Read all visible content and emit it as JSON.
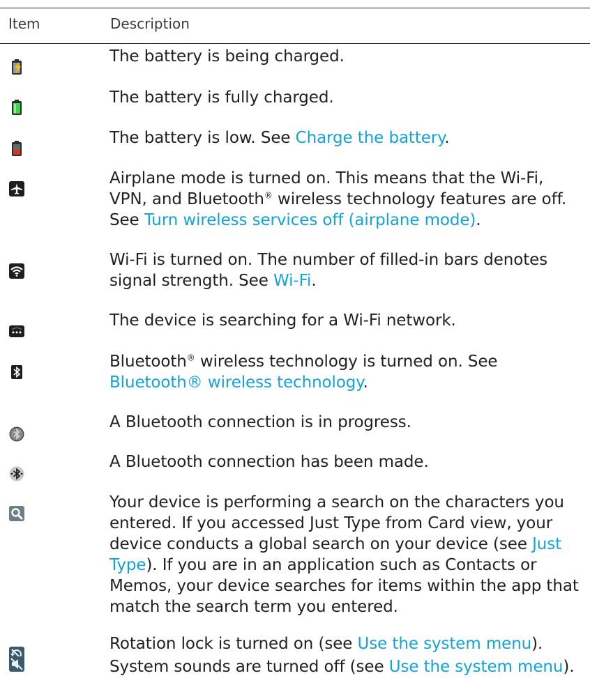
{
  "header": {
    "item": "Item",
    "description": "Description"
  },
  "colors": {
    "link": "#12a3d8",
    "text": "#231f20"
  },
  "rows": [
    {
      "icon": "battery-charging-icon",
      "text": "The battery is being charged."
    },
    {
      "icon": "battery-full-icon",
      "text": "The battery is fully charged."
    },
    {
      "icon": "battery-low-icon",
      "pre": "The battery is low. See ",
      "link": "Charge the battery",
      "post": "."
    },
    {
      "icon": "airplane-icon",
      "line1": "Airplane mode is turned on. This means that the Wi-Fi,",
      "line2_a": "VPN, and Bluetooth",
      "reg": "®",
      "line2_b": " wireless technology features are off.",
      "line3_pre": "See ",
      "link": "Turn wireless services off (airplane mode)",
      "post": "."
    },
    {
      "icon": "wifi-icon",
      "line1": "Wi-Fi is turned on. The number of filled-in bars denotes",
      "line2_pre": "signal strength. See ",
      "link": "Wi-Fi",
      "post": "."
    },
    {
      "icon": "wifi-searching-icon",
      "text": "The device is searching for a Wi-Fi network."
    },
    {
      "icon": "bluetooth-on-icon",
      "line1_a": "Bluetooth",
      "reg": "®",
      "line1_b": " wireless technology is turned on. See",
      "link": "Bluetooth® wireless technology",
      "post": "."
    },
    {
      "icon": "bluetooth-connecting-icon",
      "text": "A Bluetooth connection is in progress."
    },
    {
      "icon": "bluetooth-connected-icon",
      "text": "A Bluetooth connection has been made."
    },
    {
      "icon": "search-icon",
      "line1": "Your device is performing a search on the characters you",
      "line2": "entered. If you accessed Just Type from Card view, your",
      "line3_pre": "device conducts a global search on your device (see ",
      "link1": "Just",
      "link2": "Type",
      "line4_post": "). If you are in an application such as Contacts or",
      "line5": "Memos, your device searches for items within the app that",
      "line6": "match the search term you entered."
    },
    {
      "icon": "rotation-lock-icon",
      "pre": "Rotation lock is turned on (see ",
      "link": "Use the system menu",
      "post": ")."
    },
    {
      "icon": "sound-off-icon",
      "pre": "System sounds are turned off (see ",
      "link": "Use the system menu",
      "post": ")."
    }
  ]
}
